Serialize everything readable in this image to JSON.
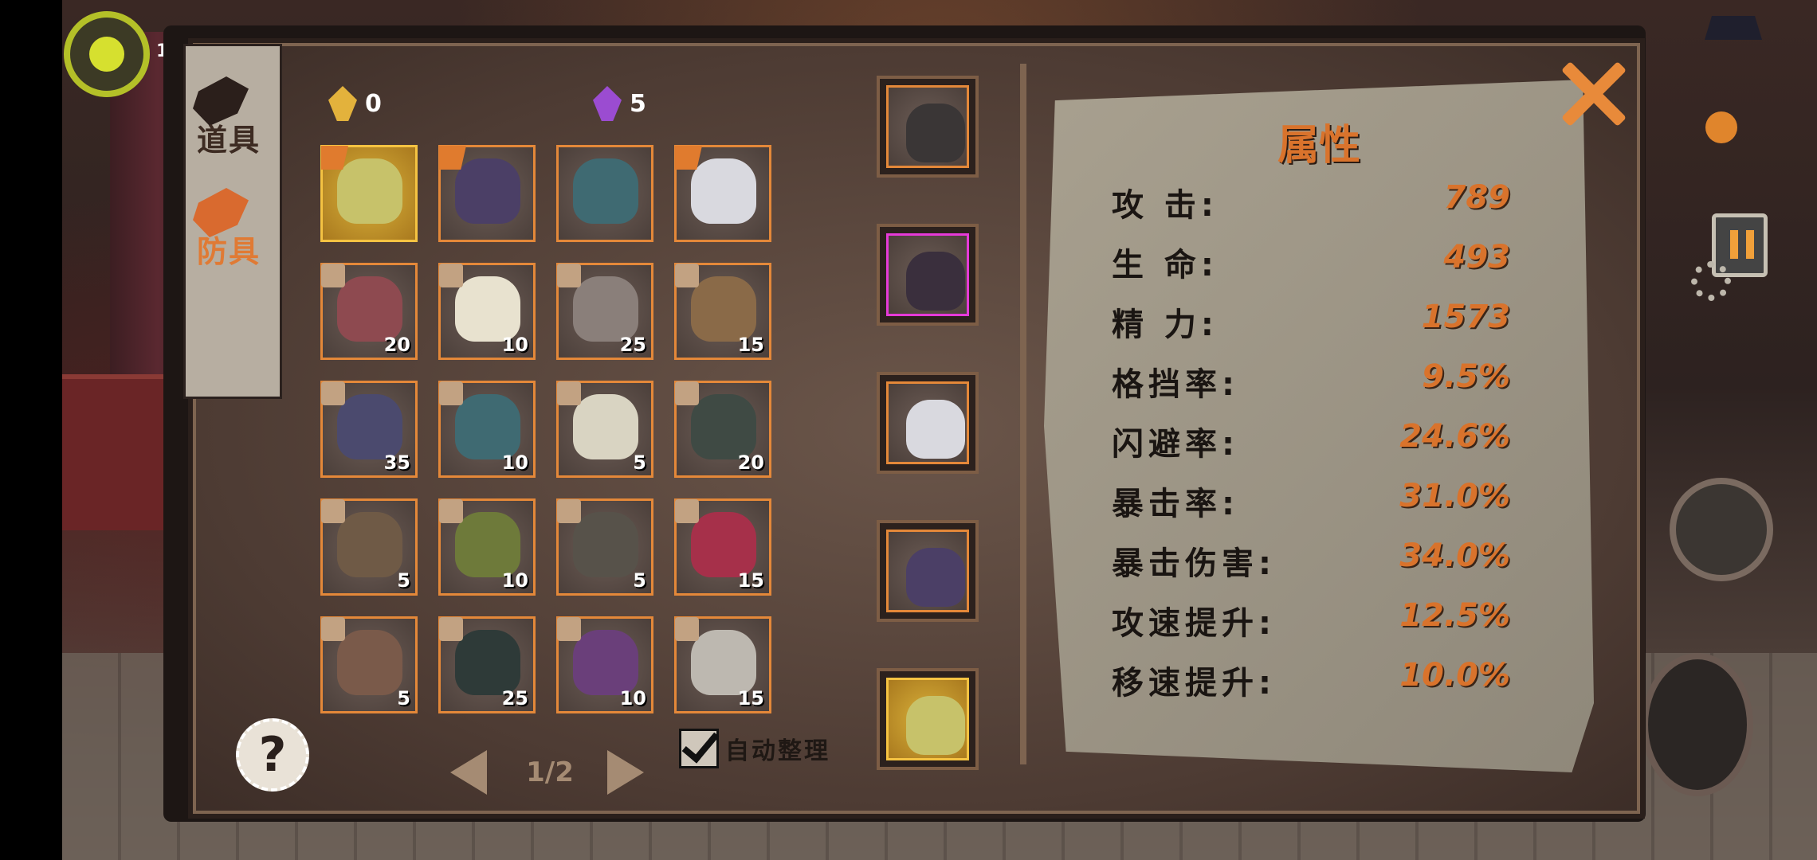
{
  "hud": {
    "level": "1"
  },
  "tabs": [
    {
      "label": "道具",
      "active": false
    },
    {
      "label": "防具",
      "active": true
    }
  ],
  "currencies": [
    {
      "icon": "gold-crystal-icon",
      "value": "0",
      "color": "#e3b23c"
    },
    {
      "icon": "purple-crystal-icon",
      "value": "5",
      "color": "#9b4cd1"
    }
  ],
  "inventory": [
    {
      "name": "gold-spiked-armor",
      "count": "",
      "badge": true,
      "selected": true,
      "color": "#c7c26a"
    },
    {
      "name": "purple-coat",
      "count": "",
      "badge": true,
      "selected": false,
      "color": "#4b3f66"
    },
    {
      "name": "horned-blue-helmet",
      "count": "",
      "badge": false,
      "selected": false,
      "color": "#3f6a72"
    },
    {
      "name": "white-mask-hood",
      "count": "",
      "badge": true,
      "selected": false,
      "color": "#d9d9df"
    },
    {
      "name": "red-vest",
      "count": "20",
      "badge": false,
      "selected": false,
      "color": "#8e4a50"
    },
    {
      "name": "white-gold-robe",
      "count": "10",
      "badge": false,
      "selected": false,
      "color": "#e8e2cf"
    },
    {
      "name": "bone-gauntlet",
      "count": "25",
      "badge": false,
      "selected": false,
      "color": "#8a7f7a"
    },
    {
      "name": "fur-bracer",
      "count": "15",
      "badge": false,
      "selected": false,
      "color": "#8a6a48"
    },
    {
      "name": "purple-coat",
      "count": "35",
      "badge": false,
      "selected": false,
      "color": "#4b4a6e"
    },
    {
      "name": "horned-blue-helmet",
      "count": "10",
      "badge": false,
      "selected": false,
      "color": "#3f6a72"
    },
    {
      "name": "gold-crown",
      "count": "5",
      "badge": false,
      "selected": false,
      "color": "#d9d4c2"
    },
    {
      "name": "green-eye-shield",
      "count": "20",
      "badge": false,
      "selected": false,
      "color": "#3f4a44"
    },
    {
      "name": "leather-wrap",
      "count": "5",
      "badge": false,
      "selected": false,
      "color": "#6f5a46"
    },
    {
      "name": "green-claw-glove",
      "count": "10",
      "badge": false,
      "selected": false,
      "color": "#6e7a3a"
    },
    {
      "name": "dark-claw-glove",
      "count": "5",
      "badge": false,
      "selected": false,
      "color": "#57524a"
    },
    {
      "name": "crimson-boots",
      "count": "15",
      "badge": false,
      "selected": false,
      "color": "#a6304a"
    },
    {
      "name": "brown-boots",
      "count": "5",
      "badge": false,
      "selected": false,
      "color": "#7a5a4a"
    },
    {
      "name": "teal-spike-boots",
      "count": "25",
      "badge": false,
      "selected": false,
      "color": "#2e3a38"
    },
    {
      "name": "purple-curl-boots",
      "count": "10",
      "badge": false,
      "selected": false,
      "color": "#6a3f7a"
    },
    {
      "name": "bandage-boots",
      "count": "15",
      "badge": false,
      "selected": false,
      "color": "#bdb8b0"
    }
  ],
  "equipped": [
    {
      "name": "weapon-slot",
      "style": "normal",
      "color": "#3a3636"
    },
    {
      "name": "cloak-slot",
      "style": "pink",
      "color": "#3a2f3d"
    },
    {
      "name": "helmet-slot",
      "style": "normal",
      "color": "#d9d9df"
    },
    {
      "name": "armor-slot",
      "style": "normal",
      "color": "#4b3f66"
    },
    {
      "name": "accessory-slot",
      "style": "gold",
      "color": "#c7c26a"
    }
  ],
  "stats": {
    "title": "属性",
    "rows": [
      {
        "label": "攻  击:",
        "value": "789"
      },
      {
        "label": "生  命:",
        "value": "493"
      },
      {
        "label": "精  力:",
        "value": "1573"
      },
      {
        "label": "格挡率:",
        "value": "9.5%"
      },
      {
        "label": "闪避率:",
        "value": "24.6%"
      },
      {
        "label": "暴击率:",
        "value": "31.0%"
      },
      {
        "label": "暴击伤害:",
        "value": "34.0%"
      },
      {
        "label": "攻速提升:",
        "value": "12.5%"
      },
      {
        "label": "移速提升:",
        "value": "10.0%"
      }
    ]
  },
  "pagination": {
    "current": "1",
    "total": "2",
    "display": "1/2"
  },
  "auto_sort": {
    "label": "自动整理",
    "checked": true
  },
  "help_label": "?"
}
